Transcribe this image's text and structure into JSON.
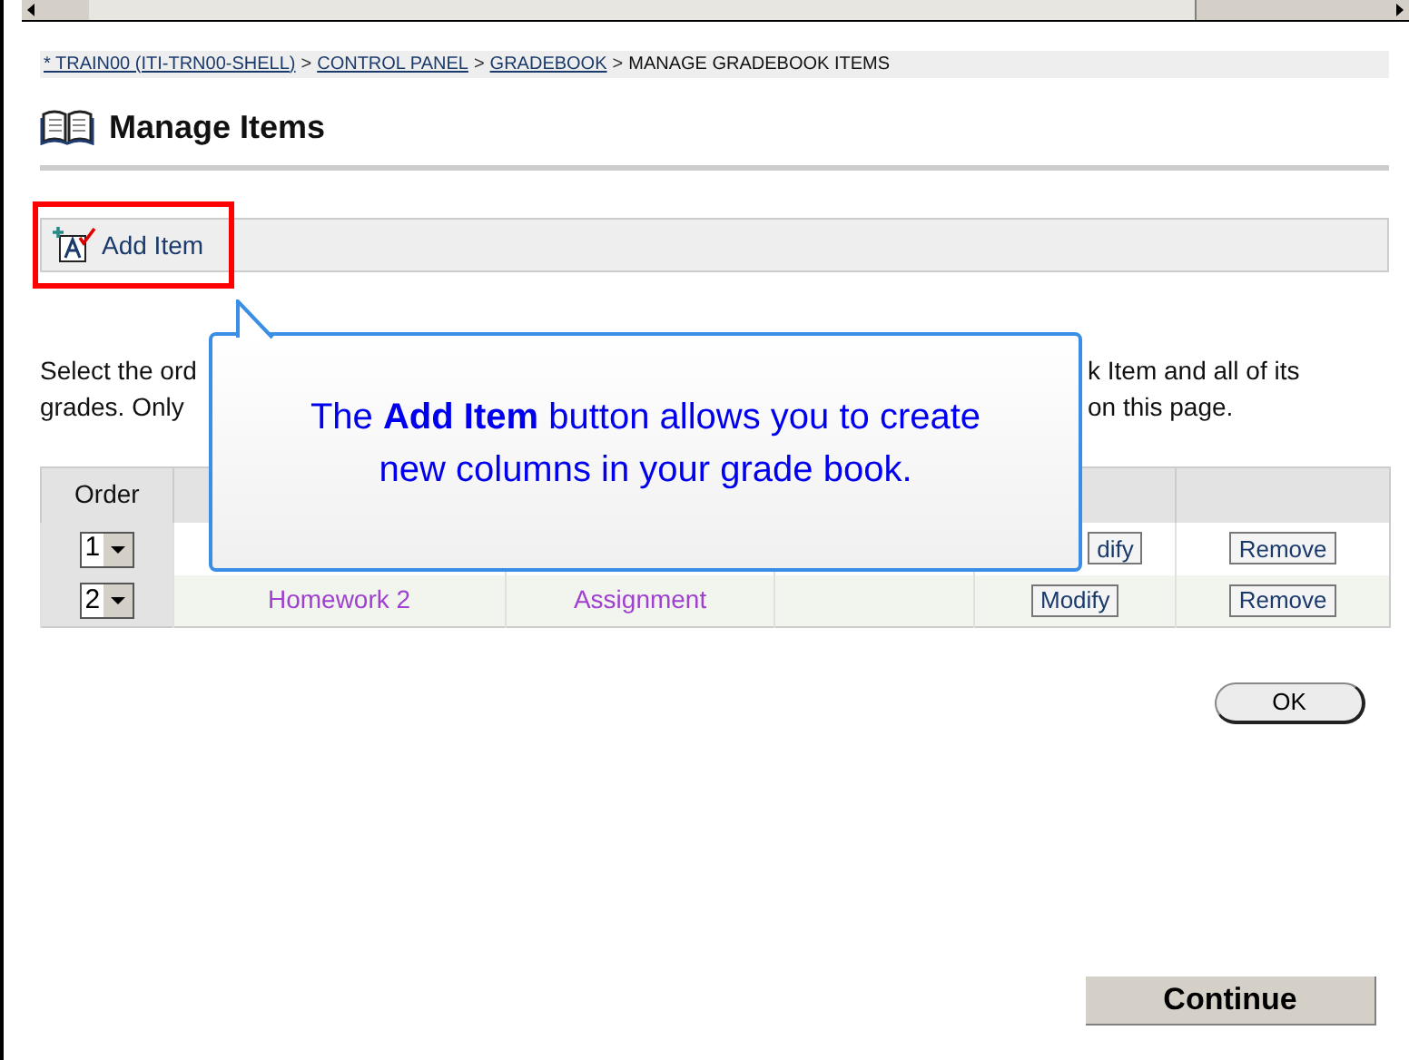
{
  "breadcrumb": [
    {
      "text": "* TRAIN00 (ITI-TRN00-SHELL)",
      "link": true
    },
    {
      "separator": ">",
      "text": "CONTROL PANEL",
      "link": true
    },
    {
      "separator": ">",
      "text": "GRADEBOOK",
      "link": true
    },
    {
      "separator": ">",
      "text": "MANAGE GRADEBOOK ITEMS",
      "link": false
    }
  ],
  "title": "Manage Items",
  "toolbar": {
    "label": "Add Item",
    "highlighted": true
  },
  "instructions": [
    {
      "start": "Select the ord",
      "end": "k Item and all of its"
    },
    {
      "start": "grades. Only",
      "end": "on this page."
    }
  ],
  "table": {
    "columns": [
      "Order"
    ],
    "rows": [
      {
        "order": "1",
        "modify": "dify",
        "remove": "Remove"
      },
      {
        "order": "2",
        "name": "Homework 2",
        "type": "Assignment",
        "modify": "Modify",
        "remove": "Remove"
      }
    ]
  },
  "callout": {
    "text": "The **Add Item** button allows you to create new columns in your grade book."
  },
  "ok_button": "OK",
  "continue_button": "Continue"
}
